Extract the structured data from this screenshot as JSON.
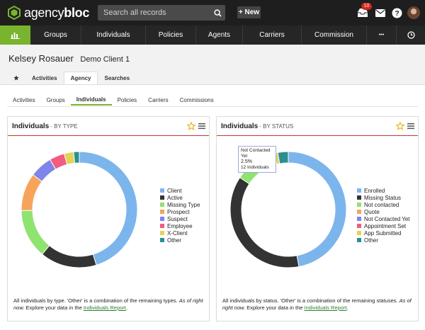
{
  "app": {
    "logo_text_light": "agency",
    "logo_text_bold": "bloc"
  },
  "search": {
    "placeholder": "Search all records"
  },
  "topbar": {
    "new_label": "+ New",
    "notification_count": "10"
  },
  "nav": {
    "items": [
      "Groups",
      "Individuals",
      "Policies",
      "Agents",
      "Carriers",
      "Commission",
      "•••"
    ]
  },
  "client": {
    "name": "Kelsey Rosauer",
    "subtitle": "Demo Client 1"
  },
  "tabs": [
    "Activities",
    "Agency",
    "Searches"
  ],
  "subtabs": [
    "Activities",
    "Groups",
    "Individuals",
    "Policies",
    "Carriers",
    "Commissions"
  ],
  "panels": {
    "left": {
      "title": "Individuals",
      "subtitle": "- BY TYPE",
      "footnote_pre": "All individuals by type. 'Other' is a combination of the remaining types.",
      "footnote_em": "As of right now.",
      "footnote_mid": "Explore your data in the",
      "footnote_link": "Individuals Report",
      "footnote_end": "."
    },
    "right": {
      "title": "Individuals",
      "subtitle": "- BY STATUS",
      "footnote_pre": "All individuals by status. 'Other' is a combination of the remaining statuses.",
      "footnote_em": "As of right now.",
      "footnote_mid": "Explore your data in the",
      "footnote_link": "Individuals Report",
      "footnote_end": ".",
      "tooltip": {
        "label": "Not Contacted Yet",
        "pct": "2.5%",
        "count": "12 Individuals"
      }
    }
  },
  "chart_data": [
    {
      "type": "pie",
      "categories": [
        "Client",
        "Active",
        "Missing Type",
        "Prospect",
        "Suspect",
        "Employee",
        "X-Client",
        "Other"
      ],
      "values": [
        43,
        15,
        13,
        10,
        6,
        4,
        2.5,
        1.5
      ],
      "colors": [
        "#7cb5ec",
        "#333333",
        "#8fe36f",
        "#f7a35c",
        "#8085e9",
        "#f15c80",
        "#e4d354",
        "#2b908f"
      ]
    },
    {
      "type": "pie",
      "categories": [
        "Enrolled",
        "Missing Status",
        "Not contacted",
        "Quote",
        "Not Contacted Yet",
        "Appointment Set",
        "App Submitted",
        "Other"
      ],
      "values": [
        48,
        38,
        5,
        2.5,
        2.5,
        2,
        1,
        3
      ],
      "colors": [
        "#7cb5ec",
        "#333333",
        "#8fe36f",
        "#f7a35c",
        "#8085e9",
        "#f15c80",
        "#e4d354",
        "#2b908f"
      ]
    }
  ]
}
